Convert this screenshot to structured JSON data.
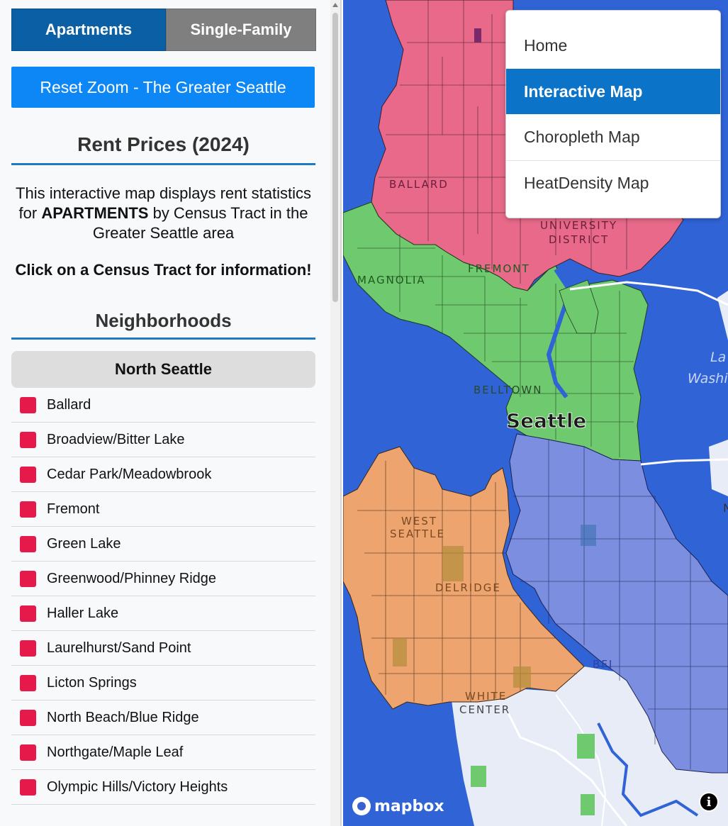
{
  "tabs": {
    "apartments": "Apartments",
    "single_family": "Single-Family"
  },
  "reset_button": "Reset Zoom - The Greater Seattle",
  "section_title": "Rent Prices (2024)",
  "description": {
    "part1": "This interactive map displays rent statistics for ",
    "bold": "APARTMENTS",
    "part2": " by Census Tract in the Greater Seattle area"
  },
  "click_message": "Click on a Census Tract for information!",
  "neighborhoods_title": "Neighborhoods",
  "region": "North Seattle",
  "swatch_color": "#e6194b",
  "neighborhoods": [
    "Ballard",
    "Broadview/Bitter Lake",
    "Cedar Park/Meadowbrook",
    "Fremont",
    "Green Lake",
    "Greenwood/Phinney Ridge",
    "Haller Lake",
    "Laurelhurst/Sand Point",
    "Licton Springs",
    "North Beach/Blue Ridge",
    "Northgate/Maple Leaf",
    "Olympic Hills/Victory Heights"
  ],
  "nav_menu": [
    "Home",
    "Interactive Map",
    "Choropleth Map",
    "HeatDensity Map"
  ],
  "nav_active": "Interactive Map",
  "map_labels": {
    "ballard": "BALLARD",
    "university": "UNIVERSITY",
    "district": "DISTRICT",
    "magnolia": "MAGNOLIA",
    "fremont": "FREMONT",
    "belltown": "BELLTOWN",
    "seattle": "Seattle",
    "west": "WEST",
    "west_seattle": "SEATTLE",
    "delridge": "DELRIDGE",
    "bfi": "BFI",
    "white": "WHITE",
    "center": "CENTER",
    "lake_1": "La",
    "lake_2": "Washi",
    "east_n": "N"
  },
  "region_colors": {
    "north": "#e8698a",
    "central": "#6fc96f",
    "west": "#eea46e",
    "south": "#7b8ee0",
    "water": "#2f63d6",
    "land": "#e8ecf7"
  },
  "attribution": {
    "logo": "mapbox",
    "info": "i"
  }
}
